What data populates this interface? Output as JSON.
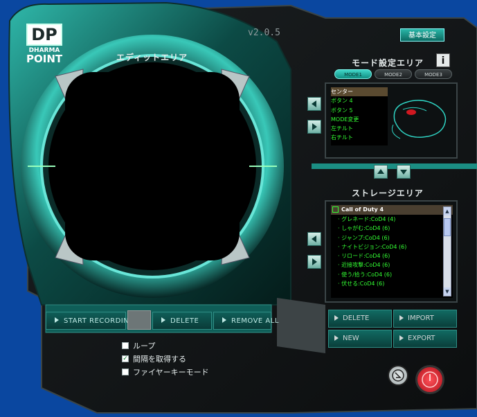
{
  "app": {
    "logo_line1": "DP",
    "logo_line2": "DHARMA",
    "logo_line3": "POINT",
    "version": "v2.0.5",
    "basic_settings_label": "基本設定"
  },
  "edit_area": {
    "title": "エディットエリア",
    "start_recording_label": "START RECORDING",
    "delete_label": "DELETE",
    "remove_all_label": "REMOVE ALL"
  },
  "options": {
    "loop_label": "ループ",
    "loop_checked": false,
    "interval_label": "間隔を取得する",
    "interval_checked": true,
    "firekey_label": "ファイヤーキーモード",
    "firekey_checked": false
  },
  "mode_area": {
    "title": "モード設定エリア",
    "info_label": "i",
    "modes": [
      {
        "label": "MODE1",
        "active": true
      },
      {
        "label": "MODE2",
        "active": false
      },
      {
        "label": "MODE3",
        "active": false
      }
    ],
    "buttons": [
      {
        "label": "センター",
        "selected": true
      },
      {
        "label": "ボタン 4",
        "selected": false
      },
      {
        "label": "ボタン 5",
        "selected": false
      },
      {
        "label": "MODE変更",
        "selected": false
      },
      {
        "label": "左チルト",
        "selected": false
      },
      {
        "label": "右チルト",
        "selected": false
      }
    ]
  },
  "storage_area": {
    "title": "ストレージエリア",
    "folder": "Call of Duty 4",
    "items": [
      "グレネード:CoD4 (4)",
      "しゃがむ:CoD4 (6)",
      "ジャンプ:CoD4 (6)",
      "ナイトビジョン:CoD4 (6)",
      "リロード:CoD4 (6)",
      "近接攻撃:CoD4 (6)",
      "使う/拾う:CoD4 (6)",
      "伏せる:CoD4 (6)"
    ],
    "delete_label": "DELETE",
    "import_label": "IMPORT",
    "new_label": "NEW",
    "export_label": "EXPORT"
  },
  "colors": {
    "background": "#0a47a0",
    "accent_teal": "#2fd3c3",
    "list_text": "#33ff33",
    "power_red": "#d01820"
  },
  "icons": {
    "minimize": "minimize-arrow-icon",
    "power": "power-icon"
  }
}
